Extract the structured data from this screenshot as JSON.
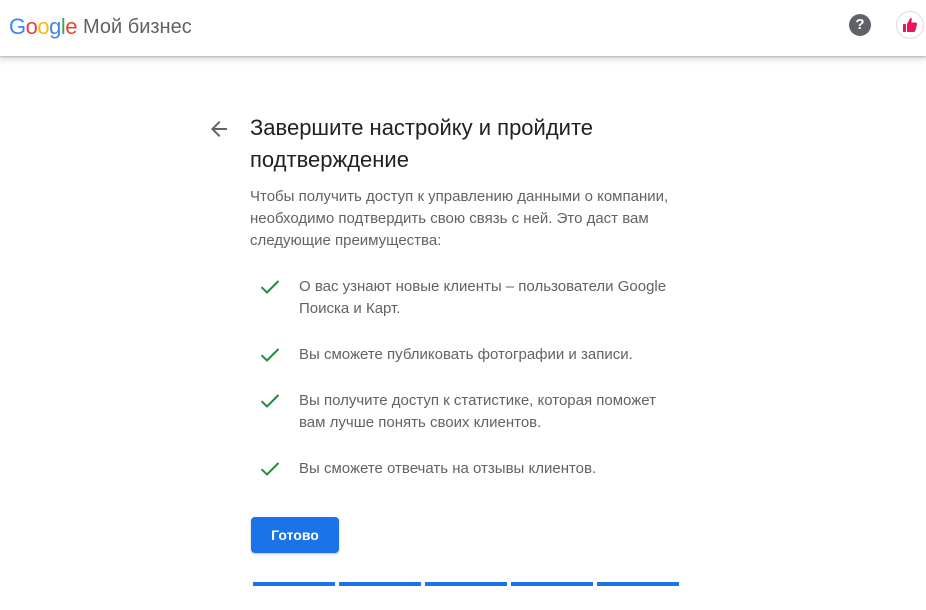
{
  "header": {
    "logo_letters": [
      {
        "char": "G",
        "color": "#4285F4"
      },
      {
        "char": "o",
        "color": "#EA4335"
      },
      {
        "char": "o",
        "color": "#FBBC05"
      },
      {
        "char": "g",
        "color": "#4285F4"
      },
      {
        "char": "l",
        "color": "#34A853"
      },
      {
        "char": "e",
        "color": "#EA4335"
      }
    ],
    "product_name": "Мой бизнес",
    "help_label": "?",
    "help_icon": "help-circle-icon",
    "avatar_icon": "thumbs-up-avatar-icon"
  },
  "main": {
    "back_icon": "arrow-back-icon",
    "title": "Завершите настройку и пройдите подтверждение",
    "description": "Чтобы получить доступ к управлению данными о компании, необходимо подтвердить свою связь с ней. Это даст вам следующие преимущества:",
    "benefits": [
      {
        "text": "О вас узнают новые клиенты – пользователи Google Поиска и Карт."
      },
      {
        "text": "Вы сможете публиковать фотографии и записи."
      },
      {
        "text": "Вы получите доступ к статистике, которая поможет вам лучше понять своих клиентов."
      },
      {
        "text": "Вы сможете отвечать на отзывы клиентов."
      }
    ],
    "done_label": "Готово",
    "progress": {
      "total_steps": 5,
      "completed_steps": 5
    }
  },
  "colors": {
    "accent": "#1a73e8",
    "check": "#1e8e3e",
    "text_primary": "#202124",
    "text_secondary": "#5f6368",
    "avatar_accent": "#e8175d"
  }
}
